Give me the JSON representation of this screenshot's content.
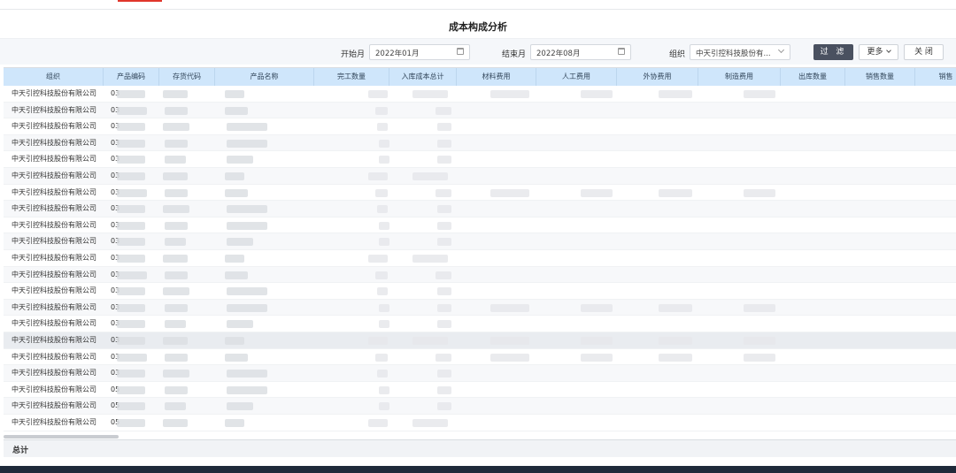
{
  "title": "成本构成分析",
  "filters": {
    "start_label": "开始月",
    "start_value": "2022年01月",
    "end_label": "结束月",
    "end_value": "2022年08月",
    "org_label": "组织",
    "org_value": "中天引控科技股份有..."
  },
  "actions": {
    "filter": "过 滤",
    "more": "更多",
    "close": "关 闭"
  },
  "table": {
    "columns": [
      "组织",
      "产品编码",
      "存货代码",
      "产品名称",
      "完工数量",
      "入库成本总计",
      "材料费用",
      "人工费用",
      "外协费用",
      "制造费用",
      "出库数量",
      "销售数量",
      "销售"
    ],
    "rows": [
      {
        "org": "中天引控科技股份有限公司",
        "code": "03"
      },
      {
        "org": "中天引控科技股份有限公司",
        "code": "03"
      },
      {
        "org": "中天引控科技股份有限公司",
        "code": "03"
      },
      {
        "org": "中天引控科技股份有限公司",
        "code": "03"
      },
      {
        "org": "中天引控科技股份有限公司",
        "code": "03"
      },
      {
        "org": "中天引控科技股份有限公司",
        "code": "03"
      },
      {
        "org": "中天引控科技股份有限公司",
        "code": "03"
      },
      {
        "org": "中天引控科技股份有限公司",
        "code": "03"
      },
      {
        "org": "中天引控科技股份有限公司",
        "code": "03"
      },
      {
        "org": "中天引控科技股份有限公司",
        "code": "03"
      },
      {
        "org": "中天引控科技股份有限公司",
        "code": "03"
      },
      {
        "org": "中天引控科技股份有限公司",
        "code": "03"
      },
      {
        "org": "中天引控科技股份有限公司",
        "code": "03"
      },
      {
        "org": "中天引控科技股份有限公司",
        "code": "03"
      },
      {
        "org": "中天引控科技股份有限公司",
        "code": "03"
      },
      {
        "org": "中天引控科技股份有限公司",
        "code": "03"
      },
      {
        "org": "中天引控科技股份有限公司",
        "code": "03"
      },
      {
        "org": "中天引控科技股份有限公司",
        "code": "03"
      },
      {
        "org": "中天引控科技股份有限公司",
        "code": "05"
      },
      {
        "org": "中天引控科技股份有限公司",
        "code": "05"
      },
      {
        "org": "中天引控科技股份有限公司",
        "code": "05"
      }
    ],
    "total_label": "总计"
  },
  "colors": {
    "header_bg": "#cfe6fb",
    "primary_button": "#4a5160",
    "accent": "#e0352b"
  }
}
